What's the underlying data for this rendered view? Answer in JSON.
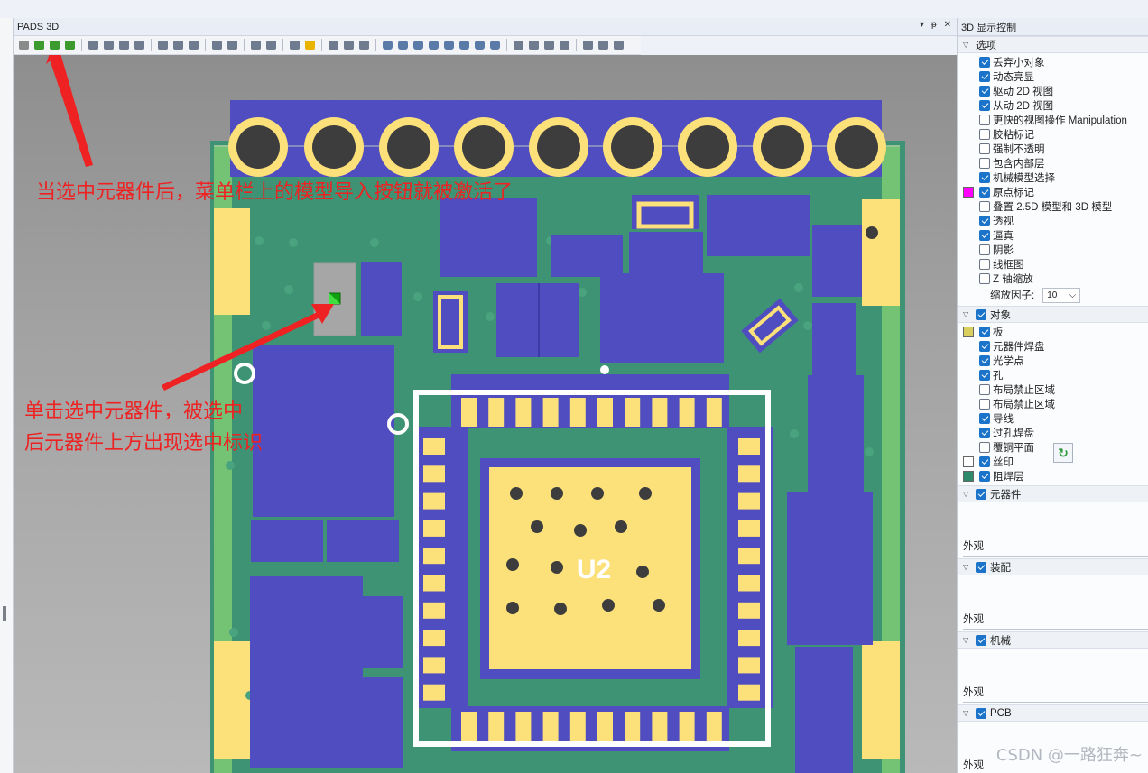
{
  "window": {
    "pane_title": "PADS 3D",
    "pane_controls": [
      "▾",
      "ᵽ",
      "✕"
    ]
  },
  "toolbar": {
    "groups": [
      [
        "import-model-disabled",
        "import-model",
        "model-b",
        "model-c"
      ],
      [
        "view-a",
        "view-b",
        "view-c",
        "view-d"
      ],
      [
        "tool-a",
        "tool-b",
        "tool-c"
      ],
      [
        "zoom-a",
        "zoom-b"
      ],
      [
        "measure-a",
        "measure-b"
      ],
      [
        "flip",
        "warning"
      ],
      [
        "active-view",
        "copy",
        "paint"
      ],
      [
        "cube-a",
        "cube-b",
        "cube-c",
        "cube-d",
        "cube-e",
        "cube-f",
        "cube-g",
        "cube-h"
      ],
      [
        "fit",
        "select",
        "rotate",
        "refresh"
      ],
      [
        "opt-a",
        "opt-b",
        "opt-c"
      ]
    ]
  },
  "viewport": {
    "component_label": "U2",
    "annotation_top": "当选中元器件后，菜单栏上的模型导入按钮就被激活了",
    "annotation_mid_line1": "单击选中元器件，被选中",
    "annotation_mid_line2": "后元器件上方出现选中标识"
  },
  "panel": {
    "title": "3D 显示控制",
    "options_header": "选项",
    "options": [
      {
        "label": "丢弃小对象",
        "checked": true
      },
      {
        "label": "动态亮显",
        "checked": true
      },
      {
        "label": "驱动 2D 视图",
        "checked": true
      },
      {
        "label": "从动 2D 视图",
        "checked": true
      },
      {
        "label": "更快的视图操作 Manipulation",
        "checked": false
      },
      {
        "label": "胶粘标记",
        "checked": false
      },
      {
        "label": "强制不透明",
        "checked": false
      },
      {
        "label": "包含内部层",
        "checked": false
      },
      {
        "label": "机械模型选择",
        "checked": true
      },
      {
        "label": "原点标记",
        "checked": true,
        "swatch": "#ff00ff"
      },
      {
        "label": "叠置 2.5D 模型和 3D 模型",
        "checked": false
      },
      {
        "label": "透视",
        "checked": true
      },
      {
        "label": "逼真",
        "checked": true
      },
      {
        "label": "阴影",
        "checked": false
      },
      {
        "label": "线框图",
        "checked": false
      },
      {
        "label": "Z 轴缩放",
        "checked": false
      }
    ],
    "scale_label": "缩放因子:",
    "scale_value": "10",
    "objects_header": "对象",
    "objects": [
      {
        "label": "板",
        "checked": true,
        "swatch": "#d8cf5e"
      },
      {
        "label": "元器件焊盘",
        "checked": true
      },
      {
        "label": "光学点",
        "checked": true
      },
      {
        "label": "孔",
        "checked": true
      },
      {
        "label": "布局禁止区域",
        "checked": false
      },
      {
        "label": "布局禁止区域",
        "checked": false
      },
      {
        "label": "导线",
        "checked": true
      },
      {
        "label": "过孔焊盘",
        "checked": true
      },
      {
        "label": "覆铜平面",
        "checked": false
      },
      {
        "label": "丝印",
        "checked": true,
        "swatch": "#ffffff"
      },
      {
        "label": "阻焊层",
        "checked": true,
        "swatch": "#2e8a6a"
      }
    ],
    "sections": [
      {
        "header": "元器件",
        "appearance": "外观"
      },
      {
        "header": "装配",
        "appearance": "外观"
      },
      {
        "header": "机械",
        "appearance": "外观"
      },
      {
        "header": "PCB",
        "appearance": "外观"
      }
    ]
  },
  "watermark": "CSDN @一路狂奔~",
  "colors": {
    "pad_blue": "#4f4dbf",
    "mask_green": "#3d9373",
    "gold": "#fce07a",
    "board_light": "#74c274",
    "annotation": "#ee2222"
  }
}
